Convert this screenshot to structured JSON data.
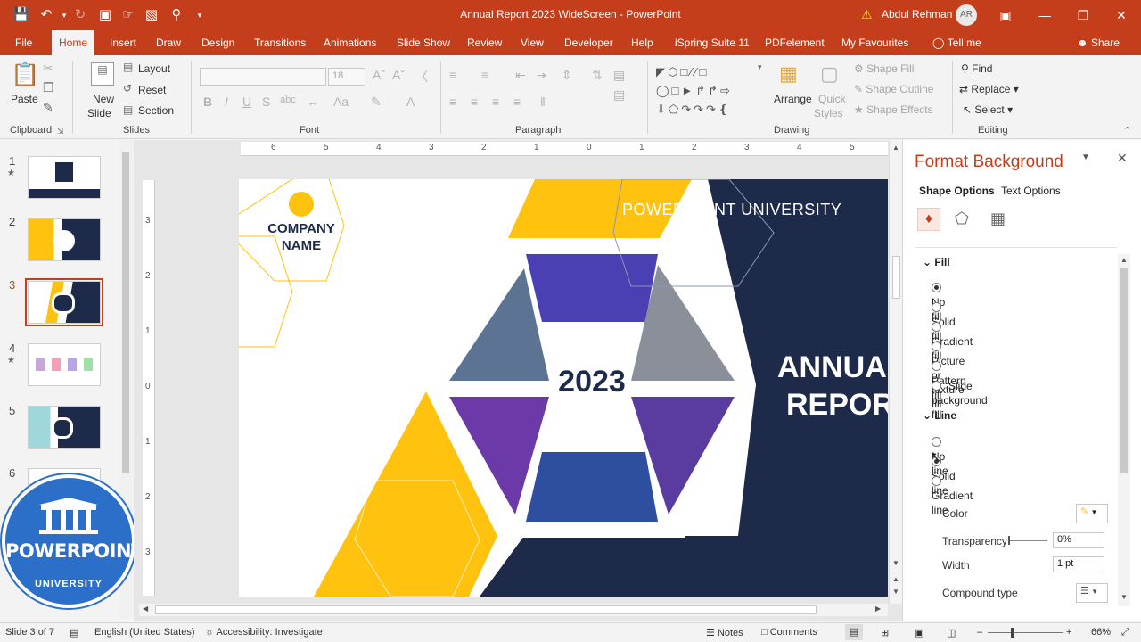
{
  "window": {
    "title": "Annual Report 2023 WideScreen  -  PowerPoint",
    "user_name": "Abdul Rehman",
    "user_initials": "AR"
  },
  "tabs": [
    "File",
    "Home",
    "Insert",
    "Draw",
    "Design",
    "Transitions",
    "Animations",
    "Slide Show",
    "Review",
    "View",
    "Developer",
    "Help",
    "iSpring Suite 11",
    "PDFelement",
    "My Favourites",
    "Tell me"
  ],
  "active_tab": "Home",
  "share_label": "Share",
  "ribbon": {
    "clipboard": {
      "label": "Clipboard",
      "paste": "Paste"
    },
    "slides": {
      "label": "Slides",
      "new_slide_1": "New",
      "new_slide_2": "Slide",
      "layout": "Layout",
      "reset": "Reset",
      "section": "Section"
    },
    "font": {
      "label": "Font",
      "size": "18"
    },
    "paragraph": {
      "label": "Paragraph"
    },
    "drawing": {
      "label": "Drawing",
      "arrange": "Arrange",
      "quick_styles_1": "Quick",
      "quick_styles_2": "Styles",
      "shape_fill": "Shape Fill",
      "shape_outline": "Shape Outline",
      "shape_effects": "Shape Effects"
    },
    "editing": {
      "label": "Editing",
      "find": "Find",
      "replace": "Replace",
      "select": "Select"
    }
  },
  "thumbnails": [
    {
      "num": "1",
      "star": true
    },
    {
      "num": "2",
      "star": false
    },
    {
      "num": "3",
      "star": false,
      "active": true
    },
    {
      "num": "4",
      "star": true
    },
    {
      "num": "5",
      "star": false
    },
    {
      "num": "6",
      "star": false
    }
  ],
  "logo": {
    "line1": "POWERPOINT",
    "line2": "UNIVERSITY"
  },
  "ruler": {
    "h_marks": [
      "6",
      "5",
      "4",
      "3",
      "2",
      "1",
      "0",
      "1",
      "2",
      "3",
      "4",
      "5",
      "6"
    ],
    "v_marks": [
      "3",
      "2",
      "1",
      "0",
      "1",
      "2",
      "3"
    ]
  },
  "slide": {
    "company_1": "COMPANY",
    "company_2": "NAME",
    "brand": "POWERPOINT UNIVERSITY",
    "year": "2023",
    "title_1": "ANNUAL",
    "title_2": "REPORT"
  },
  "pane": {
    "title": "Format Background",
    "tab_shape": "Shape Options",
    "tab_text": "Text Options",
    "fill_section": "Fill",
    "fill_options": [
      "No fill",
      "Solid fill",
      "Gradient fill",
      "Picture or texture fill",
      "Pattern fill",
      "Slide background fill"
    ],
    "fill_selected": 0,
    "line_section": "Line",
    "line_options": [
      "No line",
      "Solid line",
      "Gradient line"
    ],
    "line_selected": 1,
    "color_label": "Color",
    "transparency_label": "Transparency",
    "transparency_value": "0%",
    "width_label": "Width",
    "width_value": "1 pt",
    "compound_label": "Compound type"
  },
  "status": {
    "slide_info": "Slide 3 of 7",
    "language": "English (United States)",
    "accessibility": "Accessibility: Investigate",
    "notes": "Notes",
    "comments": "Comments",
    "zoom": "66%"
  },
  "colors": {
    "accent": "#c43e1c",
    "slide_navy": "#1e2a4a",
    "slide_yellow": "#ffc20e"
  }
}
